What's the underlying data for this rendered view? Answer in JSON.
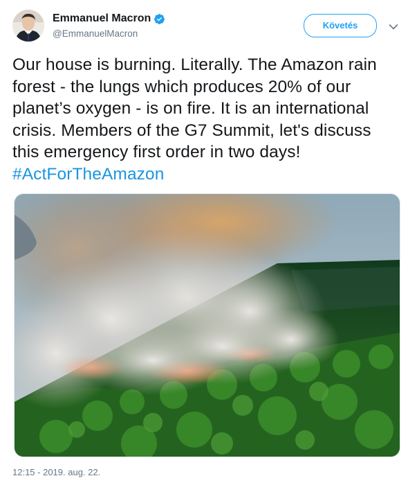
{
  "user": {
    "display_name": "Emmanuel Macron",
    "handle": "@EmmanuelMacron",
    "verified": true,
    "avatar_icon": "profile-photo"
  },
  "follow_button": {
    "label": "Követés"
  },
  "menu": {
    "icon": "chevron-down-icon"
  },
  "tweet": {
    "text_plain": "Our house is burning. Literally. The Amazon rain forest - the lungs which produces 20% of our planet’s oxygen - is on fire. It is an international crisis. Members of the G7 Summit, let's discuss this emergency first order in two days! ",
    "hashtag": "#ActForTheAmazon"
  },
  "media": {
    "type": "photo"
  },
  "timestamp": "12:15 - 2019. aug. 22.",
  "colors": {
    "link_blue": "#1b95e0",
    "button_blue": "#1da1f2",
    "secondary_text": "#657786"
  }
}
